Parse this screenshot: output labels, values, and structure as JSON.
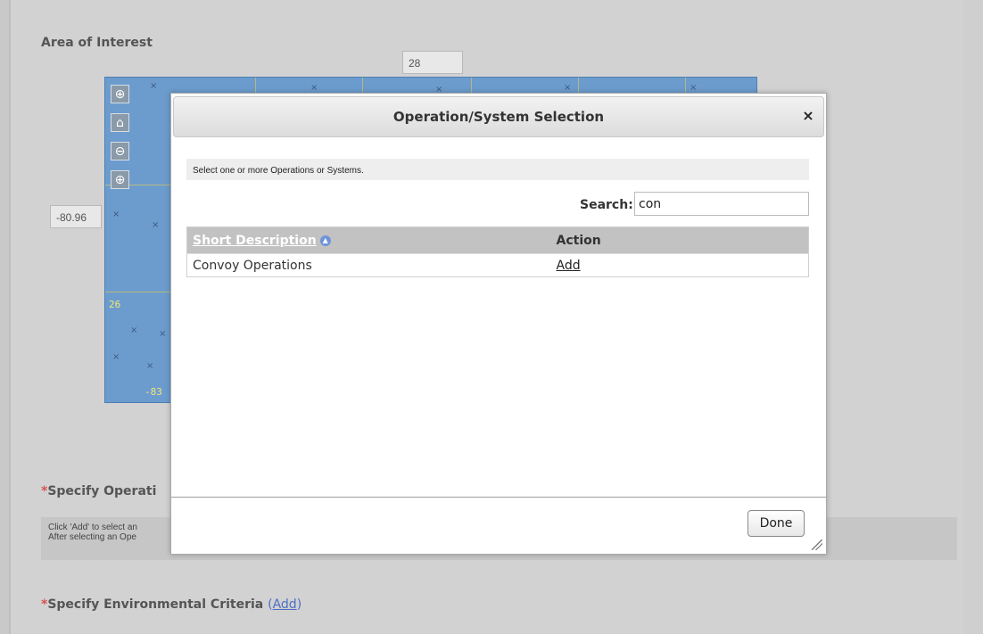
{
  "page": {
    "area_of_interest_label": "Area of Interest",
    "north_value": "28",
    "west_value": "-80.96"
  },
  "map": {
    "labels": {
      "lat_26": "26",
      "lon_partial": "-83"
    }
  },
  "dialog": {
    "title": "Operation/System Selection",
    "close_glyph": "×",
    "instructions": "Select one or more Operations or Systems.",
    "search_label": "Search:",
    "search_value": "con",
    "table": {
      "headers": [
        "Short Description",
        "Action"
      ],
      "rows": [
        {
          "description": "Convoy Operations",
          "action": "Add"
        }
      ]
    },
    "done_label": "Done"
  },
  "bottom": {
    "specify_operations_prefix": "*",
    "specify_operations_label": "Specify Operati",
    "help_line1": "Click 'Add' to select an",
    "help_line2": "After selecting an Ope",
    "env_prefix": "*",
    "env_label": "Specify Environmental Criteria",
    "env_add_label": "Add"
  }
}
